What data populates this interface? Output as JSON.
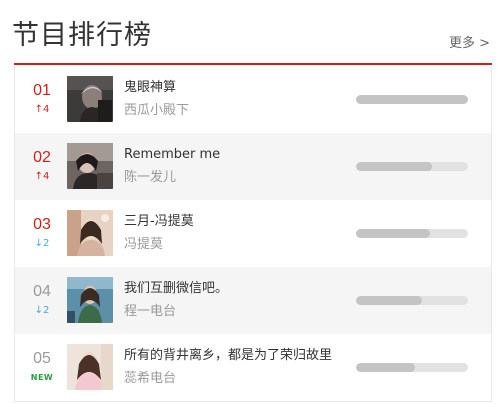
{
  "header": {
    "title": "节目排行榜",
    "more_label": "更多 >"
  },
  "colors": {
    "accent": "#c8231b",
    "down": "#49a7d9",
    "new": "#2e9a3c"
  },
  "items": [
    {
      "rank": "01",
      "trend_type": "up",
      "trend_text": "4",
      "song": "鬼眼神算",
      "artist": "西瓜小殿下",
      "popularity": 1.0,
      "rank_style": "top"
    },
    {
      "rank": "02",
      "trend_type": "up",
      "trend_text": "4",
      "song": "Remember me",
      "artist": "陈一发儿",
      "popularity": 0.68,
      "rank_style": "top"
    },
    {
      "rank": "03",
      "trend_type": "down",
      "trend_text": "2",
      "song": "三月-冯提莫",
      "artist": "冯提莫",
      "popularity": 0.66,
      "rank_style": "top"
    },
    {
      "rank": "04",
      "trend_type": "down",
      "trend_text": "2",
      "song": "我们互删微信吧。",
      "artist": "程一电台",
      "popularity": 0.59,
      "rank_style": "low"
    },
    {
      "rank": "05",
      "trend_type": "new",
      "trend_text": "NEW",
      "song": "所有的背井离乡，都是为了荣归故里",
      "artist": "蕊希电台",
      "popularity": 0.53,
      "rank_style": "low"
    }
  ]
}
